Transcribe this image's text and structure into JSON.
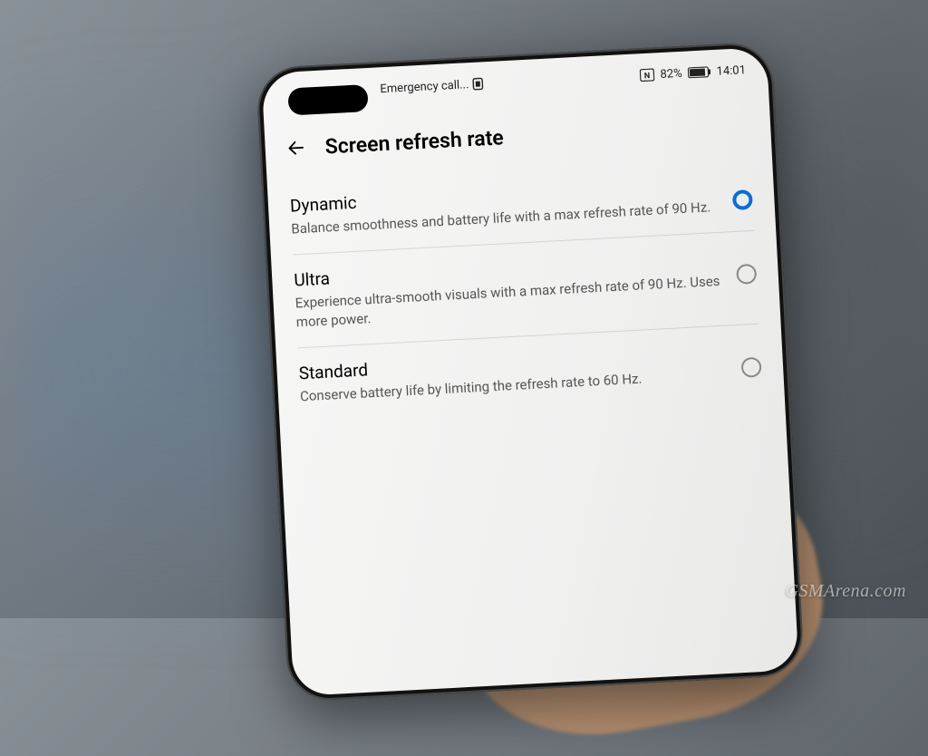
{
  "statusbar": {
    "carrier": "Emergency call...",
    "nfc_label": "N",
    "battery_percent": "82%",
    "time": "14:01"
  },
  "header": {
    "title": "Screen refresh rate"
  },
  "options": [
    {
      "title": "Dynamic",
      "description": "Balance smoothness and battery life with a max refresh rate of 90 Hz.",
      "selected": true
    },
    {
      "title": "Ultra",
      "description": "Experience ultra-smooth visuals with a max refresh rate of 90 Hz. Uses more power.",
      "selected": false
    },
    {
      "title": "Standard",
      "description": "Conserve battery life by limiting the refresh rate to 60 Hz.",
      "selected": false
    }
  ],
  "watermark": "GSMArena.com"
}
